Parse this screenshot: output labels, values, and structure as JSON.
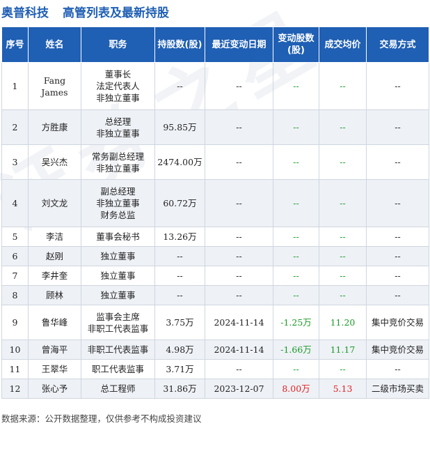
{
  "header": {
    "company": "奥普科技",
    "subtitle": "高管列表及最新持股"
  },
  "columns": [
    "序号",
    "姓名",
    "职务",
    "持股数(股)",
    "最近变动日期",
    "变动股数(股)",
    "成交均价",
    "交易方式"
  ],
  "rows": [
    {
      "no": "1",
      "name": "Fang James",
      "roles": [
        "董事长",
        "法定代表人",
        "非独立董事"
      ],
      "shares": "--",
      "date": "--",
      "change": "--",
      "price": "--",
      "method": "--"
    },
    {
      "no": "2",
      "name": "方胜康",
      "roles": [
        "总经理",
        "非独立董事"
      ],
      "shares": "95.85万",
      "date": "--",
      "change": "--",
      "price": "--",
      "method": "--"
    },
    {
      "no": "3",
      "name": "吴兴杰",
      "roles": [
        "常务副总经理",
        "非独立董事"
      ],
      "shares": "2474.00万",
      "date": "--",
      "change": "--",
      "price": "--",
      "method": "--"
    },
    {
      "no": "4",
      "name": "刘文龙",
      "roles": [
        "副总经理",
        "非独立董事",
        "财务总监"
      ],
      "shares": "60.72万",
      "date": "--",
      "change": "--",
      "price": "--",
      "method": "--"
    },
    {
      "no": "5",
      "name": "李洁",
      "roles": [
        "董事会秘书"
      ],
      "shares": "13.26万",
      "date": "--",
      "change": "--",
      "price": "--",
      "method": "--"
    },
    {
      "no": "6",
      "name": "赵刚",
      "roles": [
        "独立董事"
      ],
      "shares": "--",
      "date": "--",
      "change": "--",
      "price": "--",
      "method": "--"
    },
    {
      "no": "7",
      "name": "李井奎",
      "roles": [
        "独立董事"
      ],
      "shares": "--",
      "date": "--",
      "change": "--",
      "price": "--",
      "method": "--"
    },
    {
      "no": "8",
      "name": "顾林",
      "roles": [
        "独立董事"
      ],
      "shares": "--",
      "date": "--",
      "change": "--",
      "price": "--",
      "method": "--"
    },
    {
      "no": "9",
      "name": "鲁华峰",
      "roles": [
        "监事会主席",
        "非职工代表监事"
      ],
      "shares": "3.75万",
      "date": "2024-11-14",
      "change": "-1.25万",
      "price": "11.20",
      "method": "集中竞价交易"
    },
    {
      "no": "10",
      "name": "曾海平",
      "roles": [
        "非职工代表监事"
      ],
      "shares": "4.98万",
      "date": "2024-11-14",
      "change": "-1.66万",
      "price": "11.17",
      "method": "集中竞价交易"
    },
    {
      "no": "11",
      "name": "王翠华",
      "roles": [
        "职工代表监事"
      ],
      "shares": "3.71万",
      "date": "--",
      "change": "--",
      "price": "--",
      "method": "--"
    },
    {
      "no": "12",
      "name": "张心予",
      "roles": [
        "总工程师"
      ],
      "shares": "31.86万",
      "date": "2023-12-07",
      "change": "8.00万",
      "price": "5.13",
      "method": "二级市场买卖"
    }
  ],
  "watermark": "证券之星",
  "footer": "数据来源：公开数据整理，仅供参考不构成投资建议"
}
